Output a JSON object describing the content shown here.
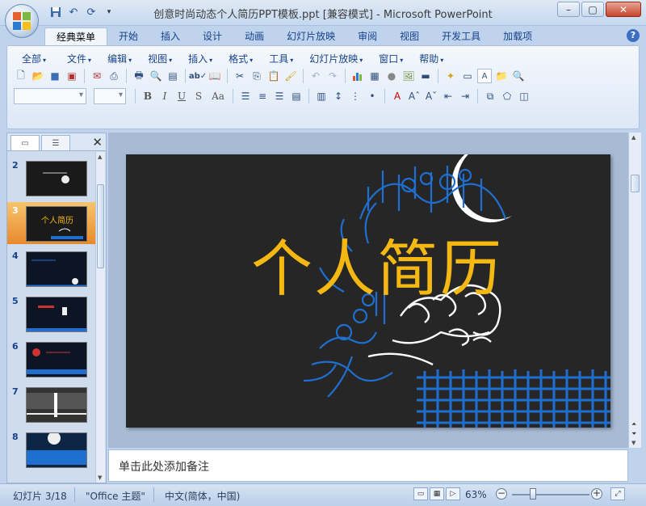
{
  "window": {
    "title": "创意时尚动态个人简历PPT模板.ppt [兼容模式] - Microsoft PowerPoint",
    "controls": {
      "minimize": "–",
      "maximize": "▢",
      "close": "✕"
    }
  },
  "quick_access": {
    "icons": [
      "save-icon",
      "undo-icon",
      "redo-icon",
      "customize-icon"
    ]
  },
  "ribbon_tabs": [
    {
      "label": "经典菜单",
      "active": true
    },
    {
      "label": "开始"
    },
    {
      "label": "插入"
    },
    {
      "label": "设计"
    },
    {
      "label": "动画"
    },
    {
      "label": "幻灯片放映"
    },
    {
      "label": "审阅"
    },
    {
      "label": "视图"
    },
    {
      "label": "开发工具"
    },
    {
      "label": "加载项"
    }
  ],
  "help": {
    "symbol": "?"
  },
  "menus": [
    "全部",
    "文件",
    "编辑",
    "视图",
    "插入",
    "格式",
    "工具",
    "幻灯片放映",
    "窗口",
    "帮助"
  ],
  "format_buttons": {
    "bold": "B",
    "italic": "I",
    "underline": "U",
    "shadow": "S",
    "case": "Aa"
  },
  "slide_panel": {
    "close": "✕",
    "slides": [
      {
        "num": "2"
      },
      {
        "num": "3",
        "selected": true,
        "text": "个人简历"
      },
      {
        "num": "4"
      },
      {
        "num": "5"
      },
      {
        "num": "6"
      },
      {
        "num": "7"
      },
      {
        "num": "8"
      }
    ]
  },
  "slide": {
    "title": "个人简历",
    "title_color": "#f5b813",
    "accent": "#1f6fd1"
  },
  "notes": {
    "placeholder": "单击此处添加备注"
  },
  "status": {
    "slide_indicator": "幻灯片 3/18",
    "theme": "\"Office 主题\"",
    "language": "中文(简体，中国)",
    "zoom": "63%"
  }
}
